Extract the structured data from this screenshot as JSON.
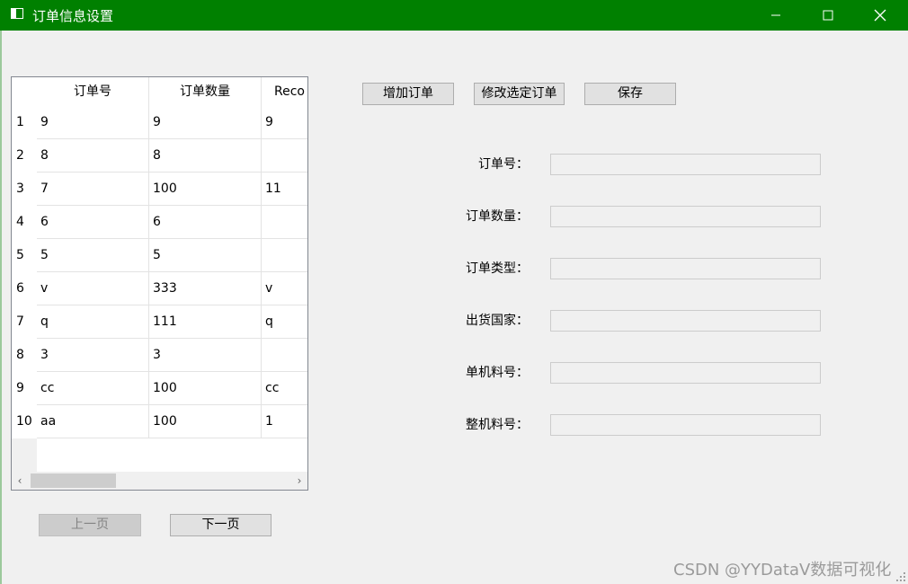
{
  "window": {
    "title": "订单信息设置"
  },
  "table": {
    "columns": [
      "订单号",
      "订单数量",
      "Reco"
    ],
    "rows": [
      {
        "num": "1",
        "cells": [
          "9",
          "9",
          "9"
        ]
      },
      {
        "num": "2",
        "cells": [
          "8",
          "8",
          ""
        ]
      },
      {
        "num": "3",
        "cells": [
          "7",
          "100",
          "11"
        ]
      },
      {
        "num": "4",
        "cells": [
          "6",
          "6",
          ""
        ]
      },
      {
        "num": "5",
        "cells": [
          "5",
          "5",
          ""
        ]
      },
      {
        "num": "6",
        "cells": [
          "v",
          "333",
          "v"
        ]
      },
      {
        "num": "7",
        "cells": [
          "q",
          "111",
          "q"
        ]
      },
      {
        "num": "8",
        "cells": [
          "3",
          "3",
          ""
        ]
      },
      {
        "num": "9",
        "cells": [
          "cc",
          "100",
          "cc"
        ]
      },
      {
        "num": "10",
        "cells": [
          "aa",
          "100",
          "1"
        ]
      }
    ]
  },
  "pager": {
    "prev_label": "上一页",
    "next_label": "下一页"
  },
  "toolbar": {
    "add_label": "增加订单",
    "edit_label": "修改选定订单",
    "save_label": "保存"
  },
  "form": {
    "fields": [
      {
        "label": "订单号：",
        "value": ""
      },
      {
        "label": "订单数量：",
        "value": ""
      },
      {
        "label": "订单类型：",
        "value": ""
      },
      {
        "label": "出货国家：",
        "value": ""
      },
      {
        "label": "单机料号：",
        "value": ""
      },
      {
        "label": "整机料号：",
        "value": ""
      }
    ]
  },
  "watermark": "CSDN @YYDataV数据可视化",
  "colors": {
    "titlebar": "#008000",
    "window_bg": "#f0f0f0"
  }
}
